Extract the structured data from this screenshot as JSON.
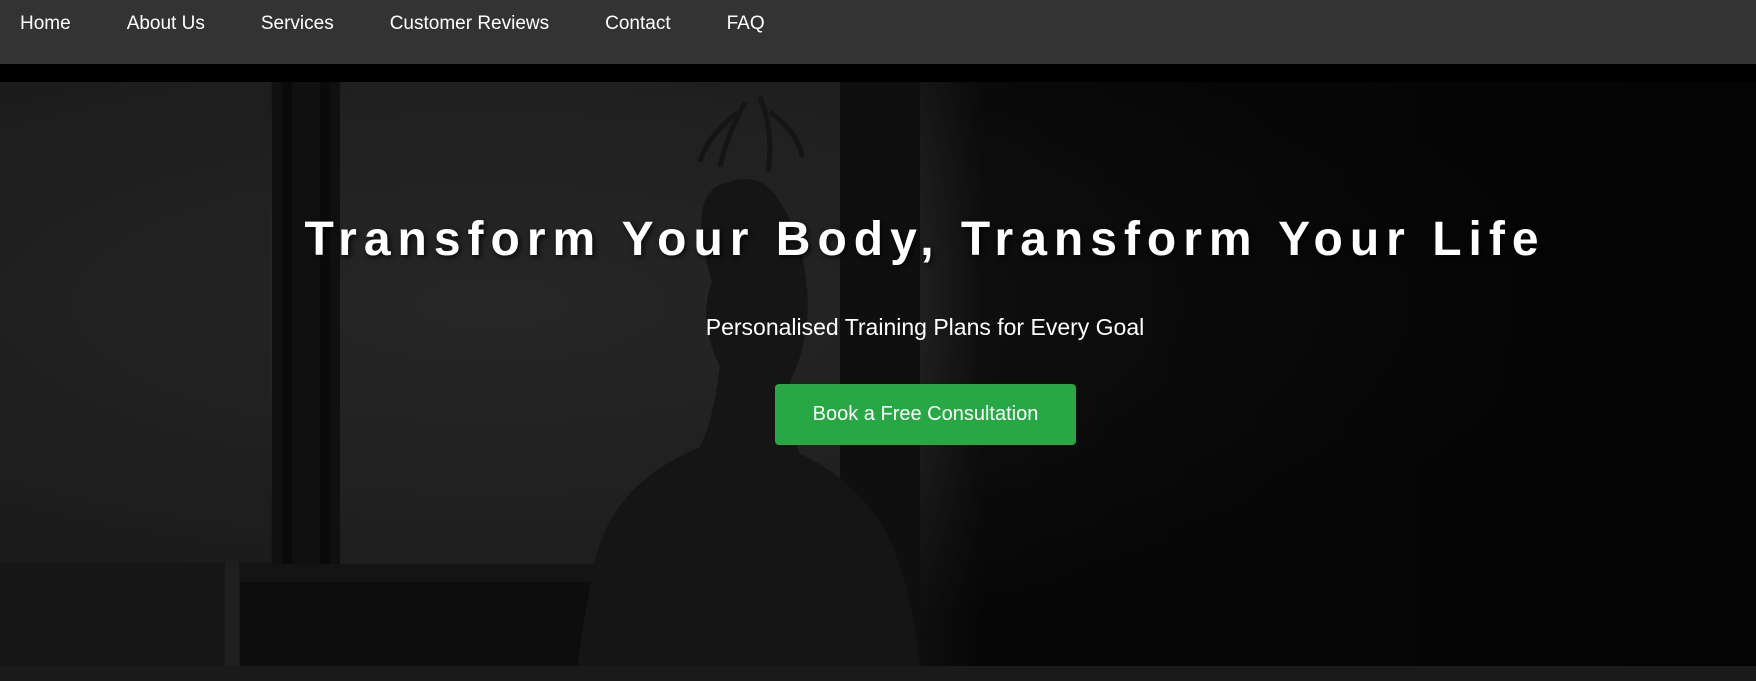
{
  "nav": {
    "items": [
      {
        "label": "Home"
      },
      {
        "label": "About Us"
      },
      {
        "label": "Services"
      },
      {
        "label": "Customer Reviews"
      },
      {
        "label": "Contact"
      },
      {
        "label": "FAQ"
      }
    ]
  },
  "hero": {
    "title": "Transform Your Body, Transform Your Life",
    "subtitle": "Personalised Training Plans for Every Goal",
    "cta_label": "Book a Free Consultation",
    "background_image": "silhouette-woman-window"
  },
  "colors": {
    "nav_background": "#333333",
    "accent": "#28a745",
    "text": "#ffffff"
  }
}
